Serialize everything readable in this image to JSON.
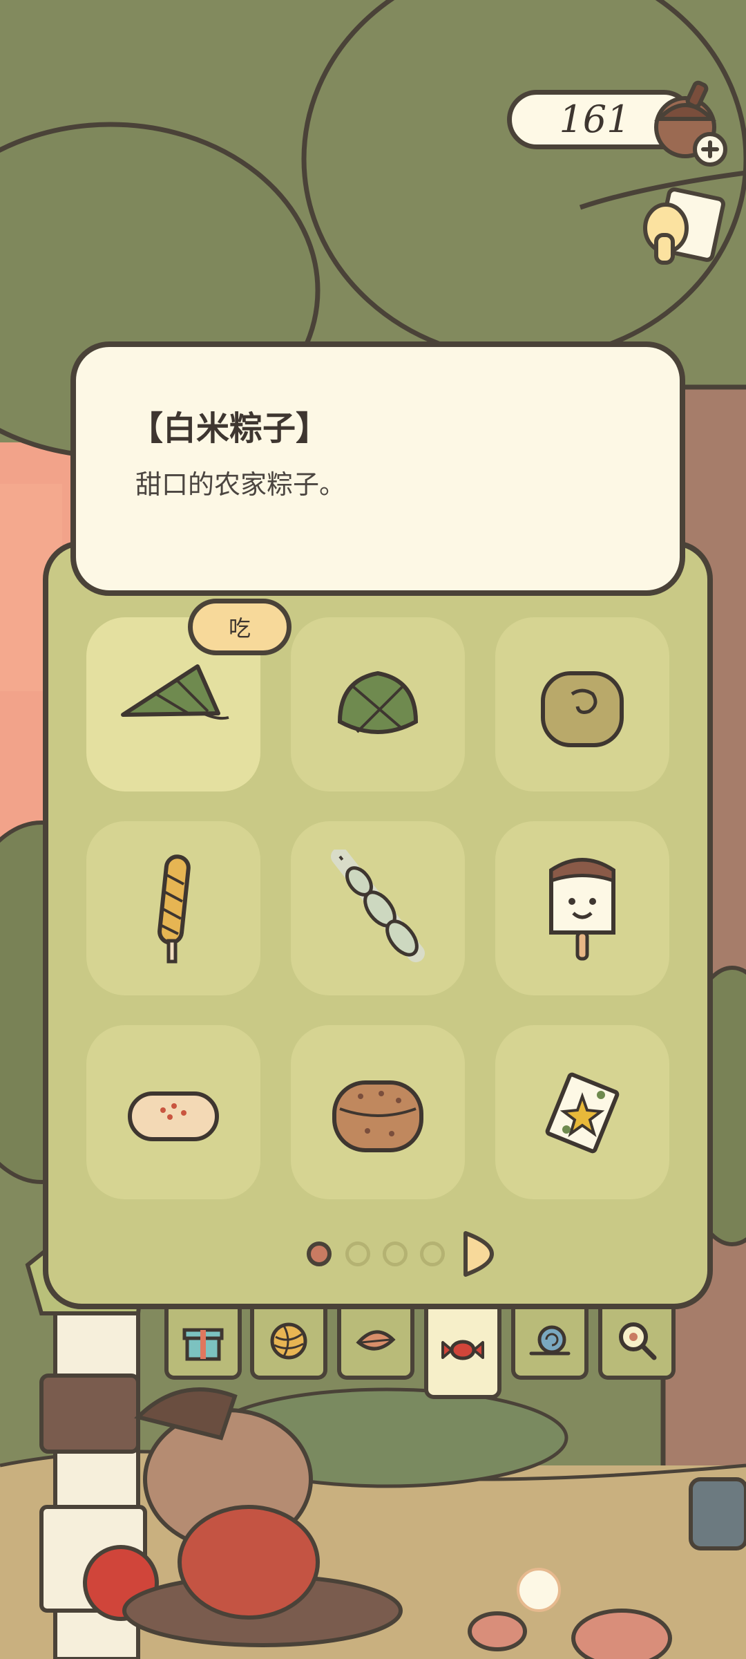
{
  "currency": {
    "amount": "161",
    "icon": "acorn-icon",
    "add_icon": "plus-icon"
  },
  "mail": {
    "icon": "letter-icon"
  },
  "selected_item": {
    "title": "【白米粽子】",
    "description": "甜口的农家粽子。"
  },
  "eat_button": {
    "label": "吃"
  },
  "items": [
    {
      "name": "white-rice-zongzi",
      "icon": "zongzi-triangle-icon",
      "selected": true
    },
    {
      "name": "leaf-wrapped-zongzi",
      "icon": "zongzi-round-icon"
    },
    {
      "name": "mooncake",
      "icon": "mooncake-icon"
    },
    {
      "name": "twisted-dough-stick",
      "icon": "twisted-stick-icon"
    },
    {
      "name": "green-dango",
      "icon": "dango-skewer-icon"
    },
    {
      "name": "smiley-popsicle",
      "icon": "popsicle-icon"
    },
    {
      "name": "pastry",
      "icon": "pastry-icon"
    },
    {
      "name": "biscuit",
      "icon": "biscuit-icon"
    },
    {
      "name": "candy-pack",
      "icon": "candy-pack-icon"
    }
  ],
  "pagination": {
    "current": 1,
    "total": 4
  },
  "tabs": [
    {
      "name": "gift",
      "icon": "gift-icon"
    },
    {
      "name": "yarn",
      "icon": "yarn-icon"
    },
    {
      "name": "leaf",
      "icon": "leaf-icon"
    },
    {
      "name": "candy",
      "icon": "candy-icon",
      "active": true
    },
    {
      "name": "snail",
      "icon": "snail-icon"
    },
    {
      "name": "magnifier",
      "icon": "magnifier-icon"
    }
  ],
  "colors": {
    "panel": "#c9c986",
    "slot": "#d6d492",
    "bubble": "#fdf8e5",
    "outline": "#4a4238",
    "tree": "#828a5e",
    "sky": "#f2a38a"
  }
}
